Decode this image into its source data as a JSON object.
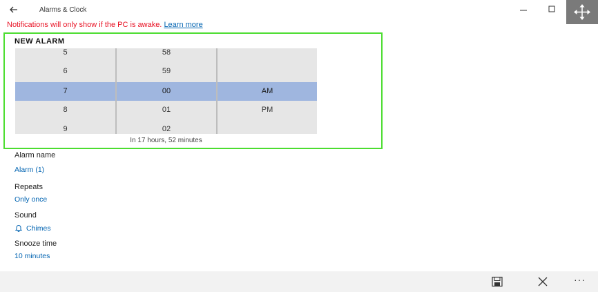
{
  "titlebar": {
    "title": "Alarms & Clock",
    "icons": [
      "back-arrow-icon",
      "minimize-icon",
      "maximize-icon",
      "move-icon"
    ]
  },
  "notice": {
    "text": "Notifications will only show if the PC is awake.",
    "link": "Learn more",
    "color": "#e81123"
  },
  "alarm": {
    "section_title": "NEW ALARM",
    "hours": [
      "5",
      "6",
      "7",
      "8",
      "9"
    ],
    "minutes": [
      "58",
      "59",
      "00",
      "01",
      "02"
    ],
    "ampm": [
      "",
      "",
      "AM",
      "PM",
      ""
    ],
    "selected": {
      "hour": "7",
      "minute": "00",
      "period": "AM"
    },
    "time_until": "In 17 hours, 52 minutes",
    "focus_color": "#4cdd30",
    "selection_color": "#9fb6df"
  },
  "fields": {
    "name_label": "Alarm name",
    "name_value": "Alarm (1)",
    "repeats_label": "Repeats",
    "repeats_value": "Only once",
    "sound_label": "Sound",
    "sound_value": "Chimes",
    "snooze_label": "Snooze time",
    "snooze_value": "10 minutes"
  },
  "commandbar": {
    "more": "···",
    "icons": [
      "save-icon",
      "close-icon"
    ]
  },
  "accent": "#0063b1"
}
